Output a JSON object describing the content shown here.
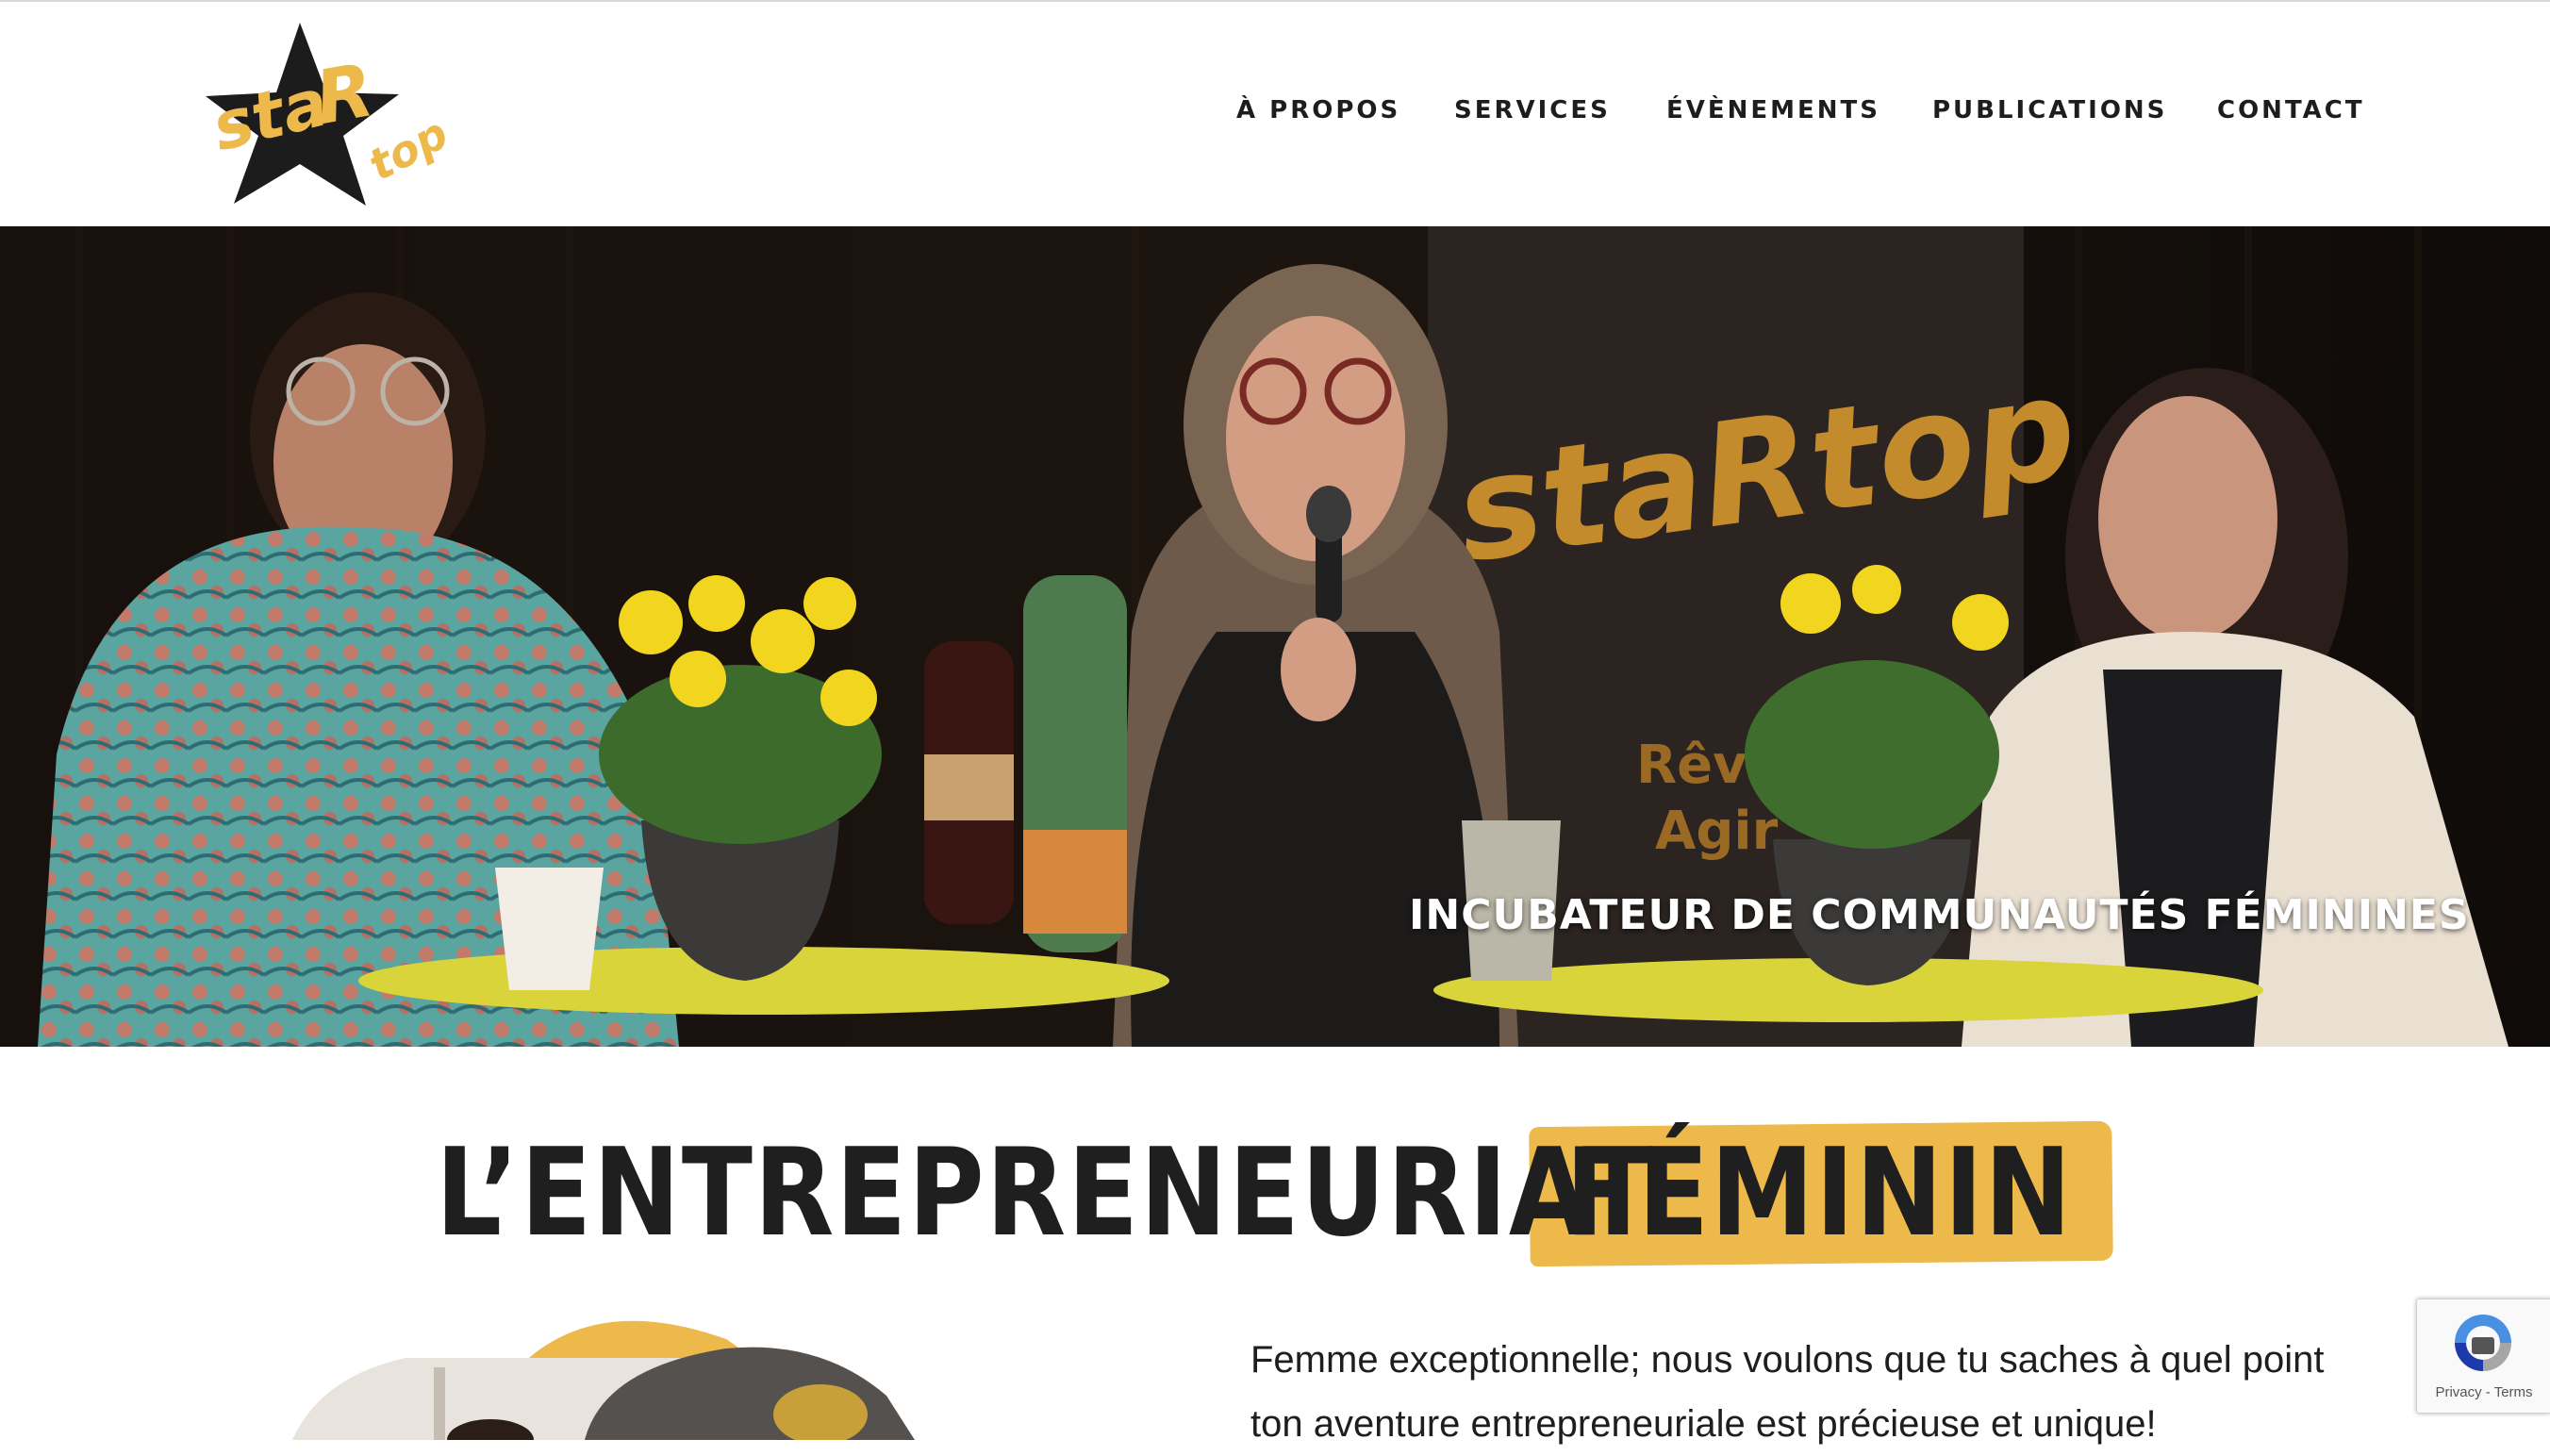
{
  "brand": {
    "logo_text_1": "sta",
    "logo_text_2": "R",
    "logo_text_3": "top",
    "accent_color": "#ecb94a"
  },
  "nav": {
    "items": [
      {
        "label": "À PROPOS"
      },
      {
        "label": "SERVICES"
      },
      {
        "label": "ÉVÈNEMENTS"
      },
      {
        "label": "PUBLICATIONS"
      },
      {
        "label": "CONTACT"
      }
    ]
  },
  "hero": {
    "caption": "INCUBATEUR DE COMMUNAUTÉS FÉMININES",
    "banner_text_1": "staRtop",
    "banner_text_2": "Rêve",
    "banner_text_3": "Agir"
  },
  "heading": {
    "part1": "L’ENTREPRENEURIAT",
    "part2": "FÉMININ"
  },
  "intro": {
    "line1": "Femme exceptionnelle; nous voulons que tu saches à quel point",
    "line2": "ton aventure entrepreneuriale est précieuse et unique!"
  },
  "recaptcha": {
    "privacy": "Privacy",
    "separator": " - ",
    "terms": "Terms"
  }
}
